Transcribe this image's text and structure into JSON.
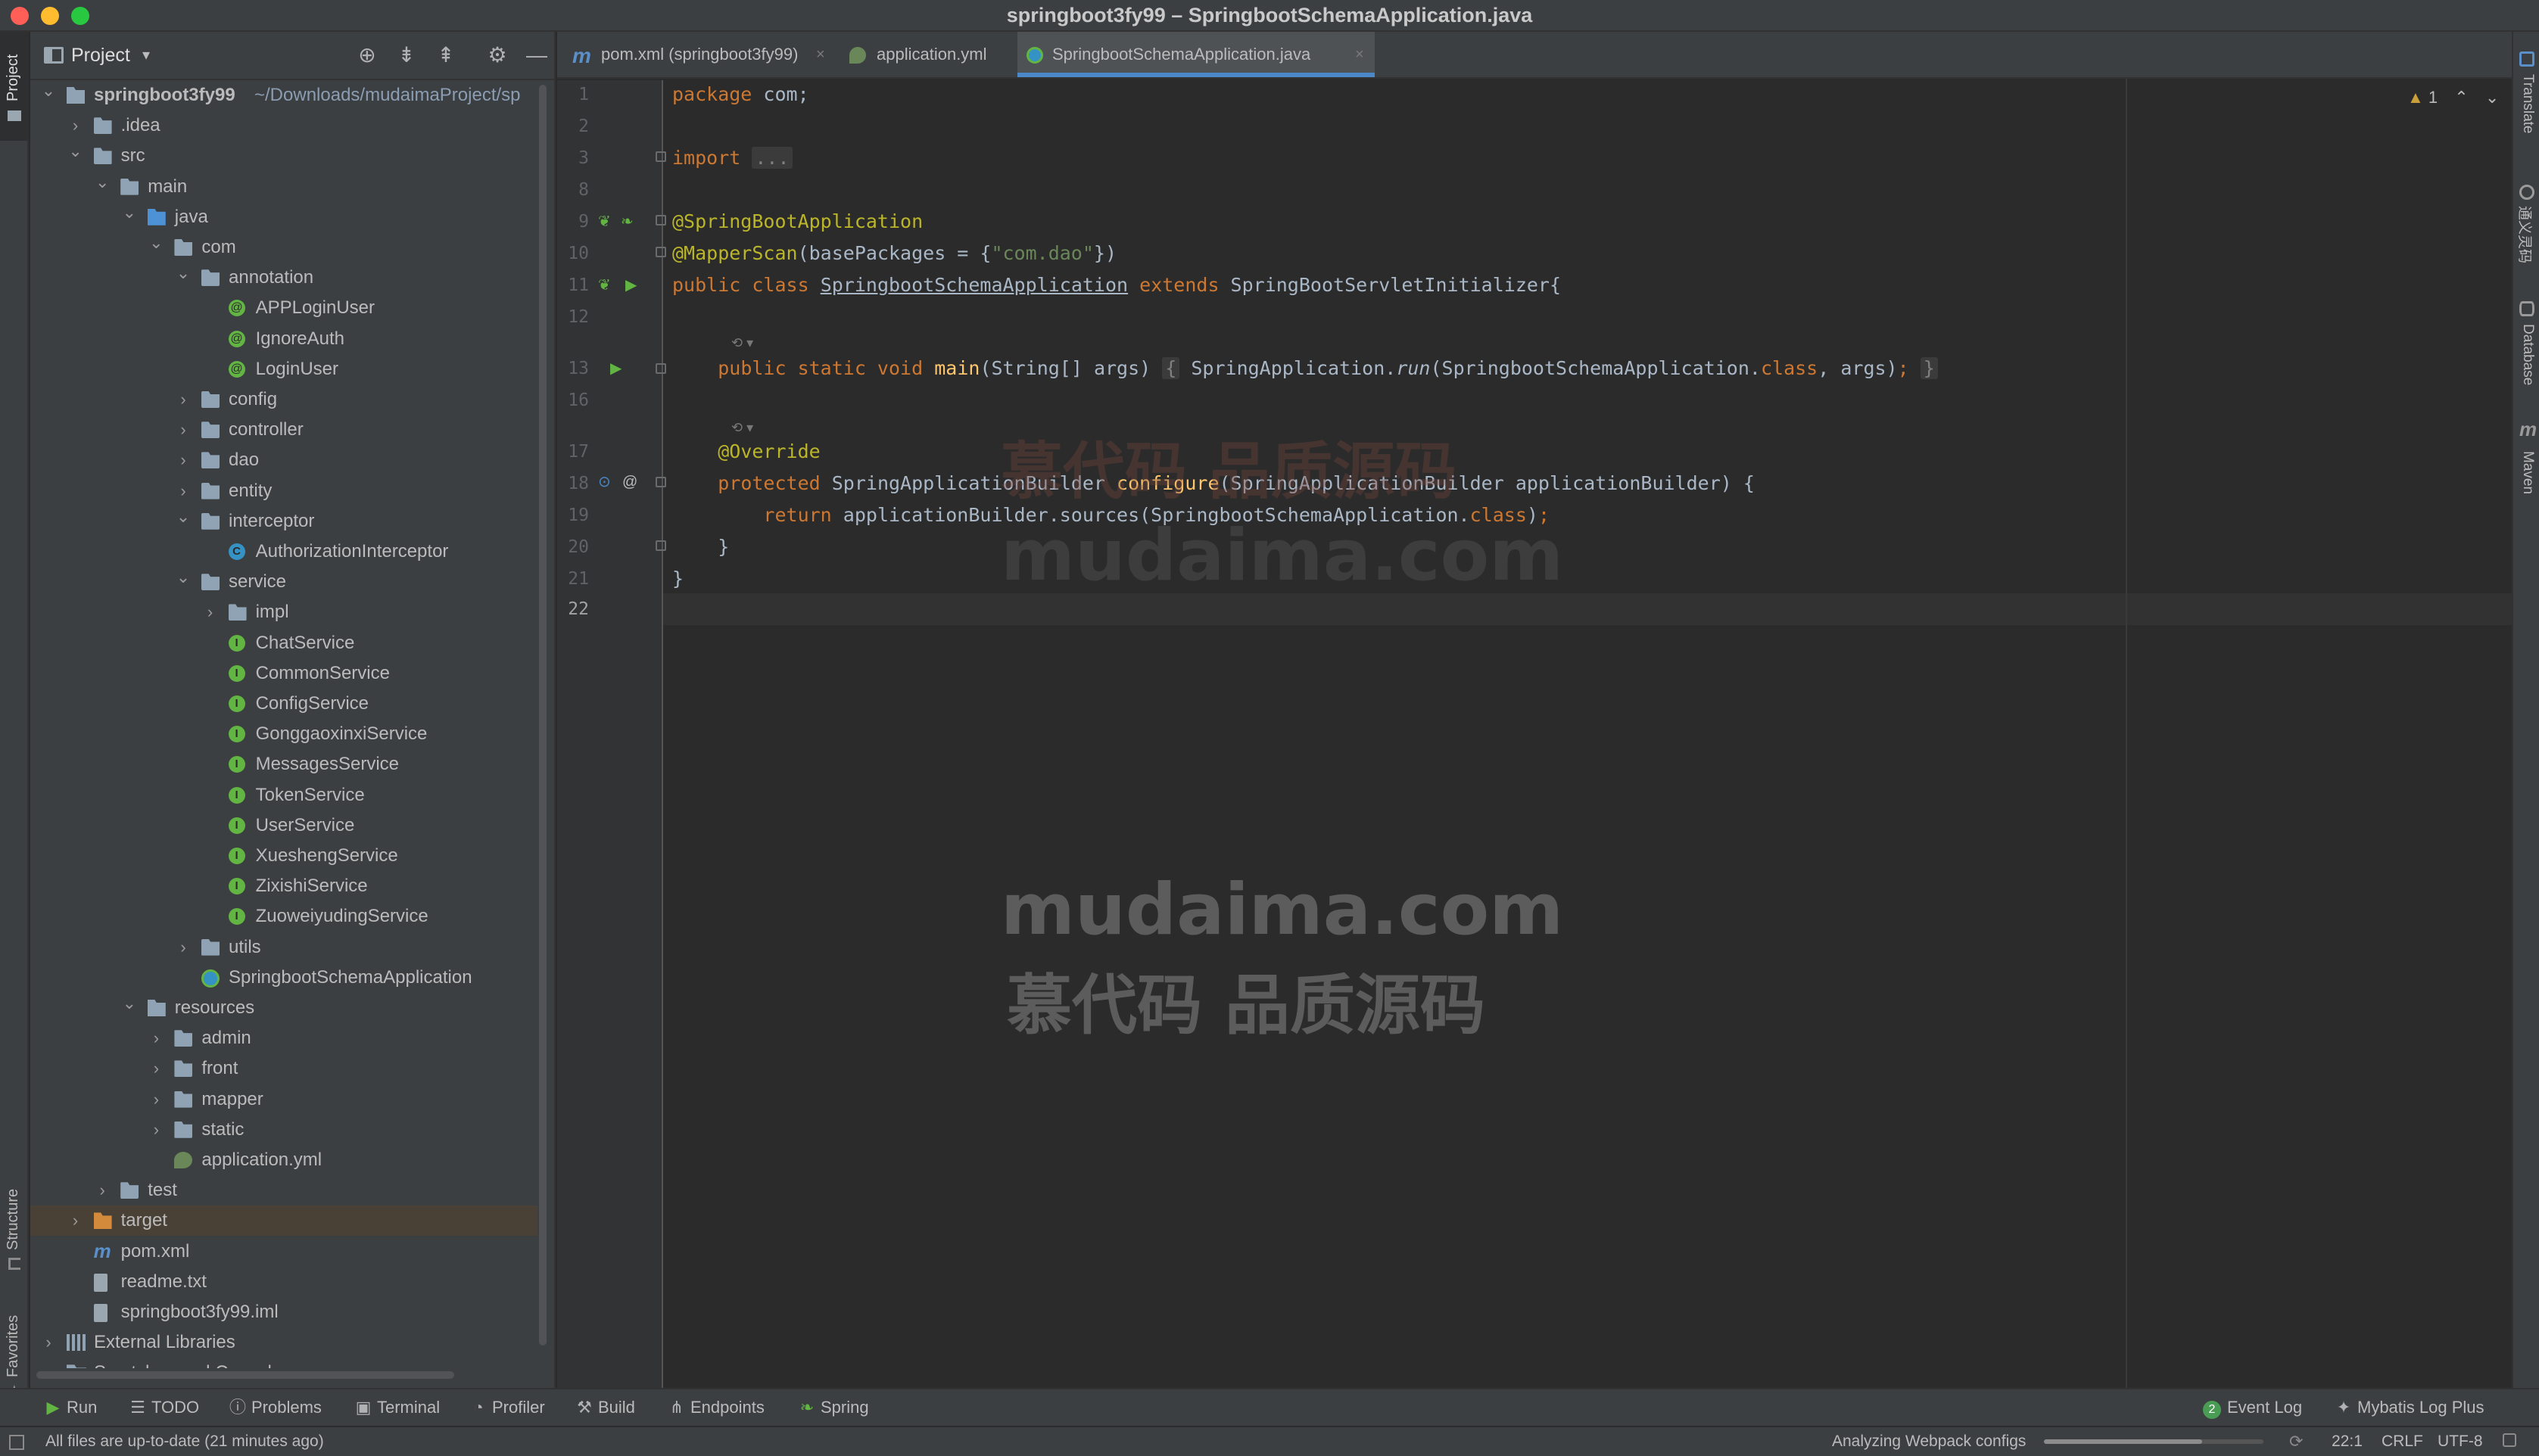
{
  "window": {
    "title": "springboot3fy99 – SpringbootSchemaApplication.java"
  },
  "left_stripe": {
    "project_tab": "Project",
    "structure_tab": "Structure",
    "favorites_tab": "Favorites"
  },
  "project_panel": {
    "title": "Project",
    "header_icons": [
      "locate-icon",
      "expand-all-icon",
      "collapse-all-icon",
      "gear-icon",
      "hide-icon"
    ],
    "tree": [
      {
        "label": "springboot3fy99",
        "path": " ~/Downloads/mudaimaProject/sp",
        "indent": 0,
        "arrow": "down",
        "icon": "module-folder",
        "bold": true
      },
      {
        "label": ".idea",
        "indent": 1,
        "arrow": "right",
        "icon": "folder"
      },
      {
        "label": "src",
        "indent": 1,
        "arrow": "down",
        "icon": "folder"
      },
      {
        "label": "main",
        "indent": 2,
        "arrow": "down",
        "icon": "folder"
      },
      {
        "label": "java",
        "indent": 3,
        "arrow": "down",
        "icon": "folder-src"
      },
      {
        "label": "com",
        "indent": 4,
        "arrow": "down",
        "icon": "folder"
      },
      {
        "label": "annotation",
        "indent": 5,
        "arrow": "down",
        "icon": "folder"
      },
      {
        "label": "APPLoginUser",
        "indent": 6,
        "arrow": "",
        "icon": "annot"
      },
      {
        "label": "IgnoreAuth",
        "indent": 6,
        "arrow": "",
        "icon": "annot"
      },
      {
        "label": "LoginUser",
        "indent": 6,
        "arrow": "",
        "icon": "annot"
      },
      {
        "label": "config",
        "indent": 5,
        "arrow": "right",
        "icon": "folder"
      },
      {
        "label": "controller",
        "indent": 5,
        "arrow": "right",
        "icon": "folder"
      },
      {
        "label": "dao",
        "indent": 5,
        "arrow": "right",
        "icon": "folder"
      },
      {
        "label": "entity",
        "indent": 5,
        "arrow": "right",
        "icon": "folder"
      },
      {
        "label": "interceptor",
        "indent": 5,
        "arrow": "down",
        "icon": "folder"
      },
      {
        "label": "AuthorizationInterceptor",
        "indent": 6,
        "arrow": "",
        "icon": "cls"
      },
      {
        "label": "service",
        "indent": 5,
        "arrow": "down",
        "icon": "folder"
      },
      {
        "label": "impl",
        "indent": 6,
        "arrow": "right",
        "icon": "folder"
      },
      {
        "label": "ChatService",
        "indent": 6,
        "arrow": "",
        "icon": "iface"
      },
      {
        "label": "CommonService",
        "indent": 6,
        "arrow": "",
        "icon": "iface"
      },
      {
        "label": "ConfigService",
        "indent": 6,
        "arrow": "",
        "icon": "iface"
      },
      {
        "label": "GonggaoxinxiService",
        "indent": 6,
        "arrow": "",
        "icon": "iface"
      },
      {
        "label": "MessagesService",
        "indent": 6,
        "arrow": "",
        "icon": "iface"
      },
      {
        "label": "TokenService",
        "indent": 6,
        "arrow": "",
        "icon": "iface"
      },
      {
        "label": "UserService",
        "indent": 6,
        "arrow": "",
        "icon": "iface"
      },
      {
        "label": "XueshengService",
        "indent": 6,
        "arrow": "",
        "icon": "iface"
      },
      {
        "label": "ZixishiService",
        "indent": 6,
        "arrow": "",
        "icon": "iface"
      },
      {
        "label": "ZuoweiyudingService",
        "indent": 6,
        "arrow": "",
        "icon": "iface"
      },
      {
        "label": "utils",
        "indent": 5,
        "arrow": "right",
        "icon": "folder"
      },
      {
        "label": "SpringbootSchemaApplication",
        "indent": 5,
        "arrow": "",
        "icon": "boot"
      },
      {
        "label": "resources",
        "indent": 3,
        "arrow": "down",
        "icon": "folder-res"
      },
      {
        "label": "admin",
        "indent": 4,
        "arrow": "right",
        "icon": "folder"
      },
      {
        "label": "front",
        "indent": 4,
        "arrow": "right",
        "icon": "folder"
      },
      {
        "label": "mapper",
        "indent": 4,
        "arrow": "right",
        "icon": "folder"
      },
      {
        "label": "static",
        "indent": 4,
        "arrow": "right",
        "icon": "folder"
      },
      {
        "label": "application.yml",
        "indent": 4,
        "arrow": "",
        "icon": "yml"
      },
      {
        "label": "test",
        "indent": 2,
        "arrow": "right",
        "icon": "folder"
      },
      {
        "label": "target",
        "indent": 1,
        "arrow": "right",
        "icon": "folder-target",
        "selected": true
      },
      {
        "label": "pom.xml",
        "indent": 1,
        "arrow": "",
        "icon": "maven"
      },
      {
        "label": "readme.txt",
        "indent": 1,
        "arrow": "",
        "icon": "txt"
      },
      {
        "label": "springboot3fy99.iml",
        "indent": 1,
        "arrow": "",
        "icon": "iml"
      },
      {
        "label": "External Libraries",
        "indent": 0,
        "arrow": "right",
        "icon": "lib"
      },
      {
        "label": "Scratches and Consoles",
        "indent": 0,
        "arrow": "right",
        "icon": "scratch"
      }
    ]
  },
  "tabs": [
    {
      "label": "pom.xml (springboot3fy99)",
      "icon": "maven-icon"
    },
    {
      "label": "application.yml",
      "icon": "yml-icon"
    },
    {
      "label": "SpringbootSchemaApplication.java",
      "icon": "spring-boot-class-icon",
      "active": true
    }
  ],
  "editor": {
    "inspection_count": "1",
    "lines": [
      {
        "n": "1",
        "html": "<span class=\"kw\">package</span> com;"
      },
      {
        "n": "2",
        "html": ""
      },
      {
        "n": "3",
        "html": "<span class=\"kw\">import</span> <span class=\"fold\">...</span>"
      },
      {
        "n": "8",
        "html": ""
      },
      {
        "n": "9",
        "html": "<span class=\"ann\">@SpringBootApplication</span>"
      },
      {
        "n": "10",
        "html": "<span class=\"ann\">@MapperScan</span>(basePackages = {<span class=\"str\">\"com.dao\"</span>})"
      },
      {
        "n": "11",
        "html": "<span class=\"kw\">public class</span> <span class=\"under\">SpringbootSchemaApplication</span> <span class=\"kw\">extends</span> SpringBootServletInitializer{"
      },
      {
        "n": "12",
        "html": ""
      },
      {
        "n": "13",
        "html": "    <span class=\"kw\">public static void</span> <span class=\"fn\">main</span>(String[] args) <span class=\"fold\">{</span> SpringApplication.<span class=\"ital\">run</span>(SpringbootSchemaApplication.<span class=\"kw\">class</span>, args)<span class=\"kw\">;</span> <span class=\"fold\">}</span>"
      },
      {
        "n": "16",
        "html": ""
      },
      {
        "n": "17",
        "html": "    <span class=\"ann\">@Override</span>"
      },
      {
        "n": "18",
        "html": "    <span class=\"kw\">protected</span> SpringApplicationBuilder <span class=\"fn\">configure</span>(SpringApplicationBuilder applicationBuilder) {"
      },
      {
        "n": "19",
        "html": "        <span class=\"kw\">return</span> applicationBuilder.sources(SpringbootSchemaApplication.<span class=\"kw\">class</span>)<span class=\"kw\">;</span>"
      },
      {
        "n": "20",
        "html": "    }"
      },
      {
        "n": "21",
        "html": "}"
      },
      {
        "n": "22",
        "html": ""
      }
    ],
    "watermark_cn": "慕代码 品质源码",
    "watermark_en": "mudaima.com"
  },
  "right_stripe": {
    "translate": "Translate",
    "wenyi": "通义灵码",
    "database": "Database",
    "maven": "Maven"
  },
  "bottom_tools": {
    "run": "Run",
    "todo": "TODO",
    "problems": "Problems",
    "terminal": "Terminal",
    "profiler": "Profiler",
    "build": "Build",
    "endpoints": "Endpoints",
    "spring": "Spring",
    "event_log": "Event Log",
    "event_log_count": "2",
    "mybatis": "Mybatis Log Plus"
  },
  "status": {
    "message": "All files are up-to-date (21 minutes ago)",
    "progress_label": "Analyzing Webpack configs",
    "progress_value": 0.72,
    "caret_position": "22:1",
    "line_separator": "CRLF",
    "encoding": "UTF-8"
  }
}
